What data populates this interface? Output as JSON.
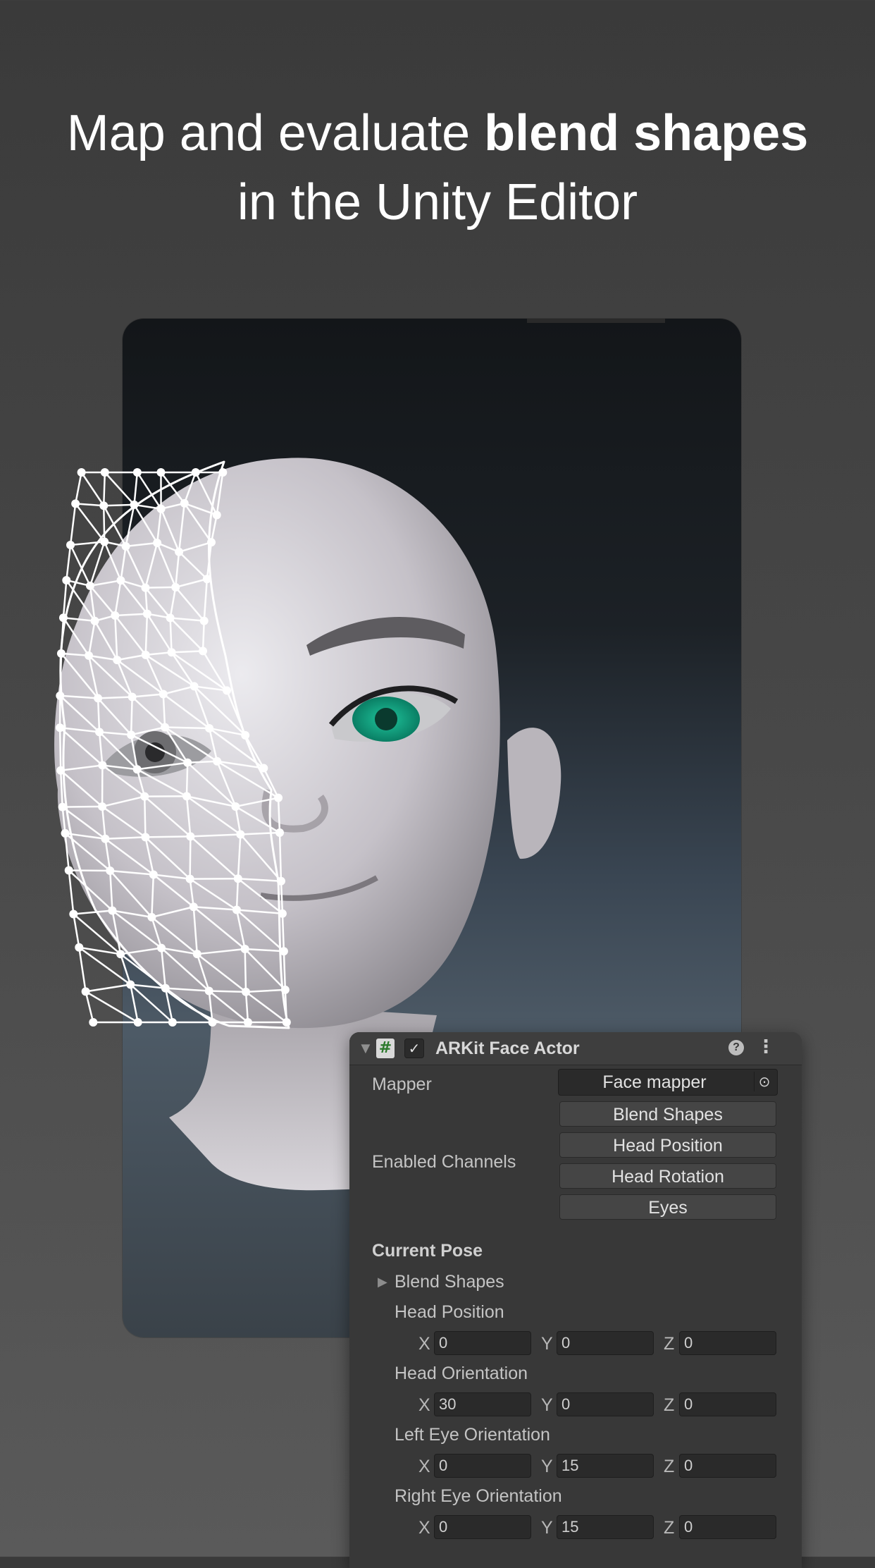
{
  "headline": {
    "line1_regular": "Map and evaluate ",
    "line1_bold": "blend shapes",
    "line2": "in the Unity Editor"
  },
  "inspector": {
    "title": "ARKit Face Actor",
    "script_icon": "hash-script-icon",
    "enabled_check": "✓",
    "help_icon": "?",
    "menu_icon": "⋮",
    "mapper_label": "Mapper",
    "mapper_value": "Face mapper",
    "enabled_channels_label": "Enabled Channels",
    "channels": [
      "Blend Shapes",
      "Head Position",
      "Head Rotation",
      "Eyes"
    ],
    "current_pose_label": "Current Pose",
    "blend_shapes_foldout": "Blend Shapes",
    "head_position": {
      "label": "Head Position",
      "x": "0",
      "y": "0",
      "z": "0"
    },
    "head_orientation": {
      "label": "Head Orientation",
      "x": "30",
      "y": "0",
      "z": "0"
    },
    "left_eye_orientation": {
      "label": "Left Eye Orientation",
      "x": "0",
      "y": "15",
      "z": "0"
    },
    "right_eye_orientation": {
      "label": "Right Eye Orientation",
      "x": "0",
      "y": "15",
      "z": "0"
    },
    "axis": {
      "x": "X",
      "y": "Y",
      "z": "Z"
    }
  },
  "colors": {
    "eye_iris": "#14a383",
    "panel_bg": "#383838",
    "mesh_wire": "#ffffff"
  }
}
